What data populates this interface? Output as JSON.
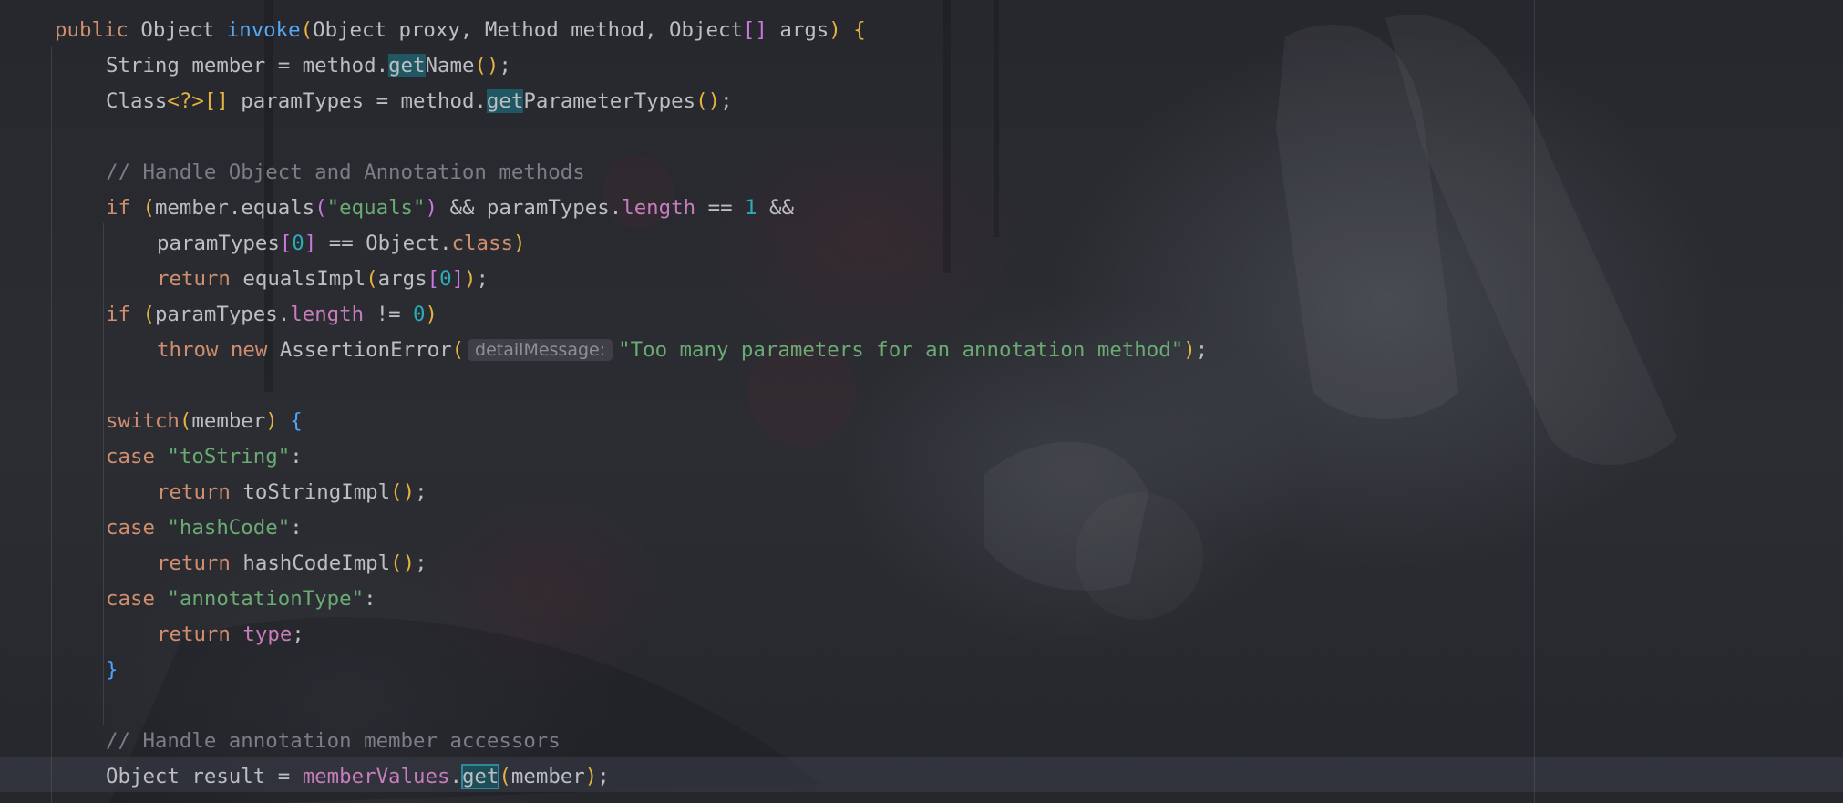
{
  "editor": {
    "colors": {
      "keyword": "#cf8e6d",
      "function": "#56a8f5",
      "string": "#6aab73",
      "number": "#2aacb8",
      "field": "#c77dbb",
      "comment": "#7a7e85",
      "text": "#bcbec4",
      "usage_highlight": "#1f5762"
    },
    "parameter_hint": {
      "label": "detailMessage:"
    },
    "lines": [
      {
        "line_id": 1,
        "tokens": [
          {
            "text": "public",
            "kind": "kw"
          },
          {
            "text": " Object ",
            "kind": "plain"
          },
          {
            "text": "invoke",
            "kind": "fn"
          },
          {
            "text": "(",
            "kind": "p1"
          },
          {
            "text": "Object proxy, Method method, Object",
            "kind": "plain"
          },
          {
            "text": "[]",
            "kind": "p2"
          },
          {
            "text": " args",
            "kind": "plain"
          },
          {
            "text": ")",
            "kind": "p1"
          },
          {
            "text": " ",
            "kind": "plain"
          },
          {
            "text": "{",
            "kind": "p1"
          }
        ]
      },
      {
        "line_id": 2,
        "tokens": [
          {
            "text": "String member = method.",
            "kind": "plain"
          },
          {
            "text": "get",
            "kind": "hl"
          },
          {
            "text": "Name",
            "kind": "plain"
          },
          {
            "text": "()",
            "kind": "p1"
          },
          {
            "text": ";",
            "kind": "plain"
          }
        ]
      },
      {
        "line_id": 3,
        "tokens": [
          {
            "text": "Class",
            "kind": "plain"
          },
          {
            "text": "<?>",
            "kind": "p1"
          },
          {
            "text": "[]",
            "kind": "p1"
          },
          {
            "text": " paramTypes = method.",
            "kind": "plain"
          },
          {
            "text": "get",
            "kind": "hl"
          },
          {
            "text": "ParameterTypes",
            "kind": "plain"
          },
          {
            "text": "()",
            "kind": "p1"
          },
          {
            "text": ";",
            "kind": "plain"
          }
        ]
      },
      {
        "line_id": 4,
        "tokens": [
          {
            "text": "// Handle Object and Annotation methods",
            "kind": "cmt"
          }
        ]
      },
      {
        "line_id": 5,
        "tokens": [
          {
            "text": "if",
            "kind": "kw"
          },
          {
            "text": " ",
            "kind": "plain"
          },
          {
            "text": "(",
            "kind": "p1"
          },
          {
            "text": "member.equals",
            "kind": "plain"
          },
          {
            "text": "(",
            "kind": "p2"
          },
          {
            "text": "\"equals\"",
            "kind": "str"
          },
          {
            "text": ")",
            "kind": "p2"
          },
          {
            "text": " && paramTypes.",
            "kind": "plain"
          },
          {
            "text": "length",
            "kind": "fld"
          },
          {
            "text": " == ",
            "kind": "plain"
          },
          {
            "text": "1",
            "kind": "num"
          },
          {
            "text": " &&",
            "kind": "plain"
          }
        ]
      },
      {
        "line_id": 6,
        "tokens": [
          {
            "text": "paramTypes",
            "kind": "plain"
          },
          {
            "text": "[",
            "kind": "p2"
          },
          {
            "text": "0",
            "kind": "num"
          },
          {
            "text": "]",
            "kind": "p2"
          },
          {
            "text": " == Object.",
            "kind": "plain"
          },
          {
            "text": "class",
            "kind": "kw"
          },
          {
            "text": ")",
            "kind": "p1"
          }
        ]
      },
      {
        "line_id": 7,
        "tokens": [
          {
            "text": "return",
            "kind": "kw"
          },
          {
            "text": " equalsImpl",
            "kind": "plain"
          },
          {
            "text": "(",
            "kind": "p1"
          },
          {
            "text": "args",
            "kind": "plain"
          },
          {
            "text": "[",
            "kind": "p2"
          },
          {
            "text": "0",
            "kind": "num"
          },
          {
            "text": "]",
            "kind": "p2"
          },
          {
            "text": ")",
            "kind": "p1"
          },
          {
            "text": ";",
            "kind": "plain"
          }
        ]
      },
      {
        "line_id": 8,
        "tokens": [
          {
            "text": "if",
            "kind": "kw"
          },
          {
            "text": " ",
            "kind": "plain"
          },
          {
            "text": "(",
            "kind": "p1"
          },
          {
            "text": "paramTypes.",
            "kind": "plain"
          },
          {
            "text": "length",
            "kind": "fld"
          },
          {
            "text": " != ",
            "kind": "plain"
          },
          {
            "text": "0",
            "kind": "num"
          },
          {
            "text": ")",
            "kind": "p1"
          }
        ]
      },
      {
        "line_id": 9,
        "tokens": [
          {
            "text": "throw",
            "kind": "kw"
          },
          {
            "text": " ",
            "kind": "plain"
          },
          {
            "text": "new",
            "kind": "kw"
          },
          {
            "text": " AssertionError",
            "kind": "plain"
          },
          {
            "text": "(",
            "kind": "p1"
          },
          {
            "text": "",
            "kind": "hint"
          },
          {
            "text": "\"Too many parameters for an annotation method\"",
            "kind": "str"
          },
          {
            "text": ")",
            "kind": "p1"
          },
          {
            "text": ";",
            "kind": "plain"
          }
        ]
      },
      {
        "line_id": 10,
        "tokens": [
          {
            "text": "switch",
            "kind": "kw"
          },
          {
            "text": "(",
            "kind": "p1"
          },
          {
            "text": "member",
            "kind": "plain"
          },
          {
            "text": ")",
            "kind": "p1"
          },
          {
            "text": " ",
            "kind": "plain"
          },
          {
            "text": "{",
            "kind": "p3"
          }
        ]
      },
      {
        "line_id": 11,
        "tokens": [
          {
            "text": "case",
            "kind": "kw"
          },
          {
            "text": " ",
            "kind": "plain"
          },
          {
            "text": "\"toString\"",
            "kind": "str"
          },
          {
            "text": ":",
            "kind": "plain"
          }
        ]
      },
      {
        "line_id": 12,
        "tokens": [
          {
            "text": "return",
            "kind": "kw"
          },
          {
            "text": " toStringImpl",
            "kind": "plain"
          },
          {
            "text": "()",
            "kind": "p1"
          },
          {
            "text": ";",
            "kind": "plain"
          }
        ]
      },
      {
        "line_id": 13,
        "tokens": [
          {
            "text": "case",
            "kind": "kw"
          },
          {
            "text": " ",
            "kind": "plain"
          },
          {
            "text": "\"hashCode\"",
            "kind": "str"
          },
          {
            "text": ":",
            "kind": "plain"
          }
        ]
      },
      {
        "line_id": 14,
        "tokens": [
          {
            "text": "return",
            "kind": "kw"
          },
          {
            "text": " hashCodeImpl",
            "kind": "plain"
          },
          {
            "text": "()",
            "kind": "p1"
          },
          {
            "text": ";",
            "kind": "plain"
          }
        ]
      },
      {
        "line_id": 15,
        "tokens": [
          {
            "text": "case",
            "kind": "kw"
          },
          {
            "text": " ",
            "kind": "plain"
          },
          {
            "text": "\"annotationType\"",
            "kind": "str"
          },
          {
            "text": ":",
            "kind": "plain"
          }
        ]
      },
      {
        "line_id": 16,
        "tokens": [
          {
            "text": "return",
            "kind": "kw"
          },
          {
            "text": " ",
            "kind": "plain"
          },
          {
            "text": "type",
            "kind": "fld"
          },
          {
            "text": ";",
            "kind": "plain"
          }
        ]
      },
      {
        "line_id": 17,
        "tokens": [
          {
            "text": "}",
            "kind": "p3"
          }
        ]
      },
      {
        "line_id": 18,
        "tokens": [
          {
            "text": "// Handle annotation member accessors",
            "kind": "cmt"
          }
        ]
      },
      {
        "line_id": 19,
        "tokens": [
          {
            "text": "Object result = ",
            "kind": "plain"
          },
          {
            "text": "memberValues",
            "kind": "fld"
          },
          {
            "text": ".",
            "kind": "plain"
          },
          {
            "text": "get",
            "kind": "hl-strong"
          },
          {
            "text": "(",
            "kind": "p1"
          },
          {
            "text": "member",
            "kind": "plain"
          },
          {
            "text": ")",
            "kind": "p1"
          },
          {
            "text": ";",
            "kind": "plain"
          }
        ]
      }
    ]
  }
}
